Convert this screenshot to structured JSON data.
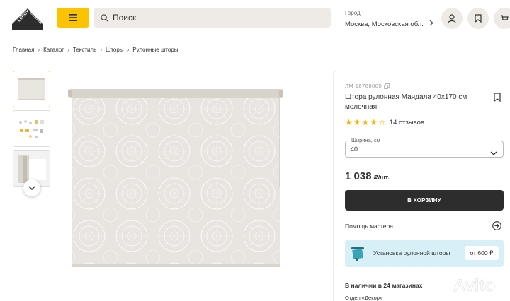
{
  "header": {
    "search_placeholder": "Поиск",
    "city_label": "Город",
    "city_value": "Москва, Московская обл.",
    "brand_color": "#fdc300"
  },
  "breadcrumbs": [
    "Главная",
    "Каталог",
    "Текстиль",
    "Шторы",
    "Рулонные шторы"
  ],
  "gallery": {
    "thumbnails": [
      "photo-roller-blind",
      "photo-mounting-parts",
      "photo-installed-detail"
    ],
    "active_index": 0
  },
  "product": {
    "sku": "ЛМ 18768000",
    "title": "Штора рулонная Мандала 40х170 см молочная",
    "rating": 4,
    "rating_max": 5,
    "reviews": "14 отзывов",
    "width_label": "Ширина, см",
    "width_value": "40",
    "price": "1 038",
    "price_unit": "₽/шт.",
    "cart_label": "В КОРЗИНУ",
    "master_help": "Помощь мастера",
    "install_label": "Установка рулонной шторы",
    "install_price": "от 600 ₽",
    "stock": "В наличии в 24 магазинах",
    "department": "Отдел «Декор»"
  },
  "watermark": "Avito",
  "logo_text": "LEROY MERLIN"
}
